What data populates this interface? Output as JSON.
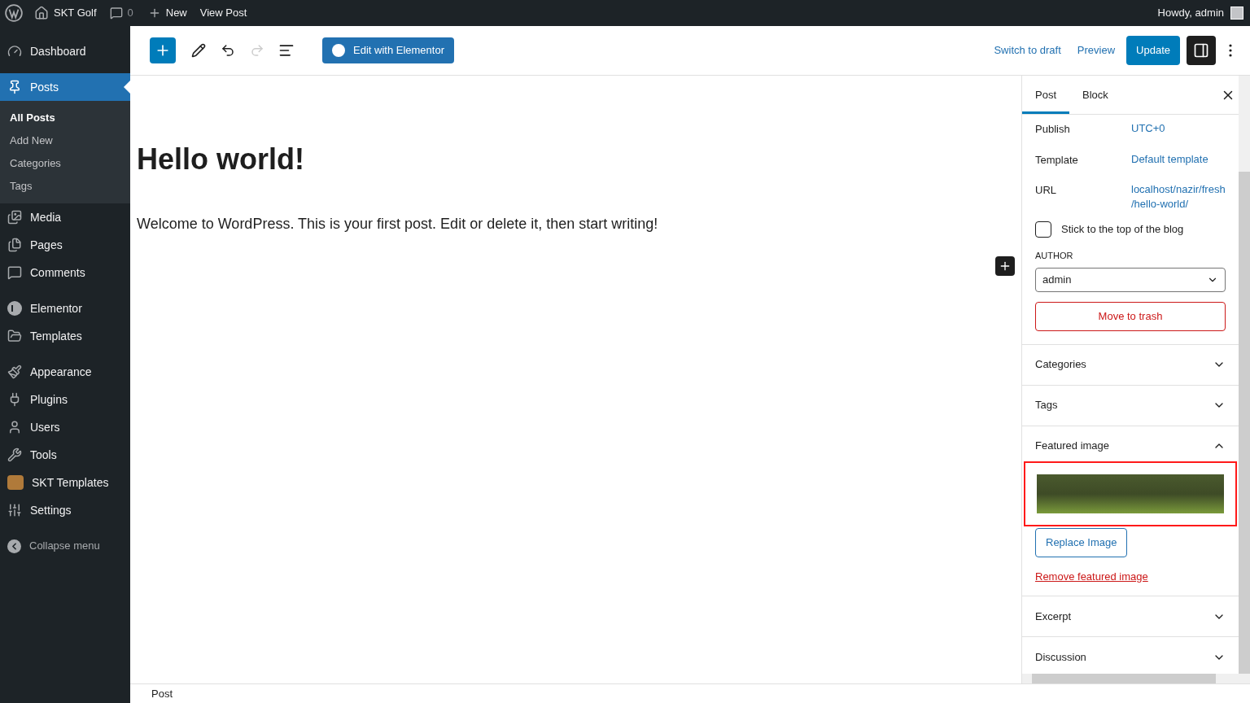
{
  "admin_bar": {
    "site": "SKT Golf",
    "comments": "0",
    "new": "New",
    "view": "View Post",
    "greeting": "Howdy, admin"
  },
  "sidebar": {
    "sections": [
      {
        "items": [
          {
            "label": "Dashboard",
            "selected": false
          }
        ]
      },
      {
        "items": [
          {
            "label": "Posts",
            "selected": true,
            "children": [
              {
                "label": "All Posts",
                "selected": true
              },
              {
                "label": "Add New",
                "selected": false
              },
              {
                "label": "Categories",
                "selected": false
              },
              {
                "label": "Tags",
                "selected": false
              }
            ]
          },
          {
            "label": "Media",
            "selected": false
          },
          {
            "label": "Pages",
            "selected": false
          },
          {
            "label": "Comments",
            "selected": false
          }
        ]
      },
      {
        "items": [
          {
            "label": "Elementor",
            "selected": false
          },
          {
            "label": "Templates",
            "selected": false
          }
        ]
      },
      {
        "items": [
          {
            "label": "Appearance",
            "selected": false
          },
          {
            "label": "Plugins",
            "selected": false
          },
          {
            "label": "Users",
            "selected": false
          },
          {
            "label": "Tools",
            "selected": false
          },
          {
            "label": "SKT Templates",
            "selected": false
          },
          {
            "label": "Settings",
            "selected": false
          }
        ]
      }
    ],
    "collapse": "Collapse menu"
  },
  "toolbar": {
    "undo": {
      "disabled": false
    },
    "redo": {
      "disabled": true
    },
    "elementor_button": "Edit with Elementor",
    "switch_to_draft": "Switch to draft",
    "preview": "Preview",
    "update": "Update",
    "settings_open": true
  },
  "post": {
    "title": "Hello world!",
    "body": "Welcome to WordPress. This is your first post. Edit or delete it, then start writing!"
  },
  "settings_panel": {
    "tabs": [
      {
        "label": "Post",
        "selected": true
      },
      {
        "label": "Block",
        "selected": false
      }
    ],
    "rows": [
      {
        "label": "Publish",
        "value": "UTC+0"
      },
      {
        "label": "Template",
        "value": "Default template"
      },
      {
        "label": "URL",
        "value": "localhost/nazir/fresh\n/hello-world/"
      }
    ],
    "sticky": {
      "label": "Stick to the top of the blog",
      "checked": false
    },
    "author": {
      "label": "AUTHOR",
      "value": "admin"
    },
    "trash": "Move to trash",
    "panels": [
      {
        "title": "Categories",
        "expanded": false
      },
      {
        "title": "Tags",
        "expanded": false
      },
      {
        "title": "Featured image",
        "expanded": true,
        "highlighted": true,
        "replace": "Replace Image",
        "remove": "Remove featured image"
      },
      {
        "title": "Excerpt",
        "expanded": false
      },
      {
        "title": "Discussion",
        "expanded": false
      }
    ]
  },
  "footer": {
    "breadcrumb": "Post"
  }
}
